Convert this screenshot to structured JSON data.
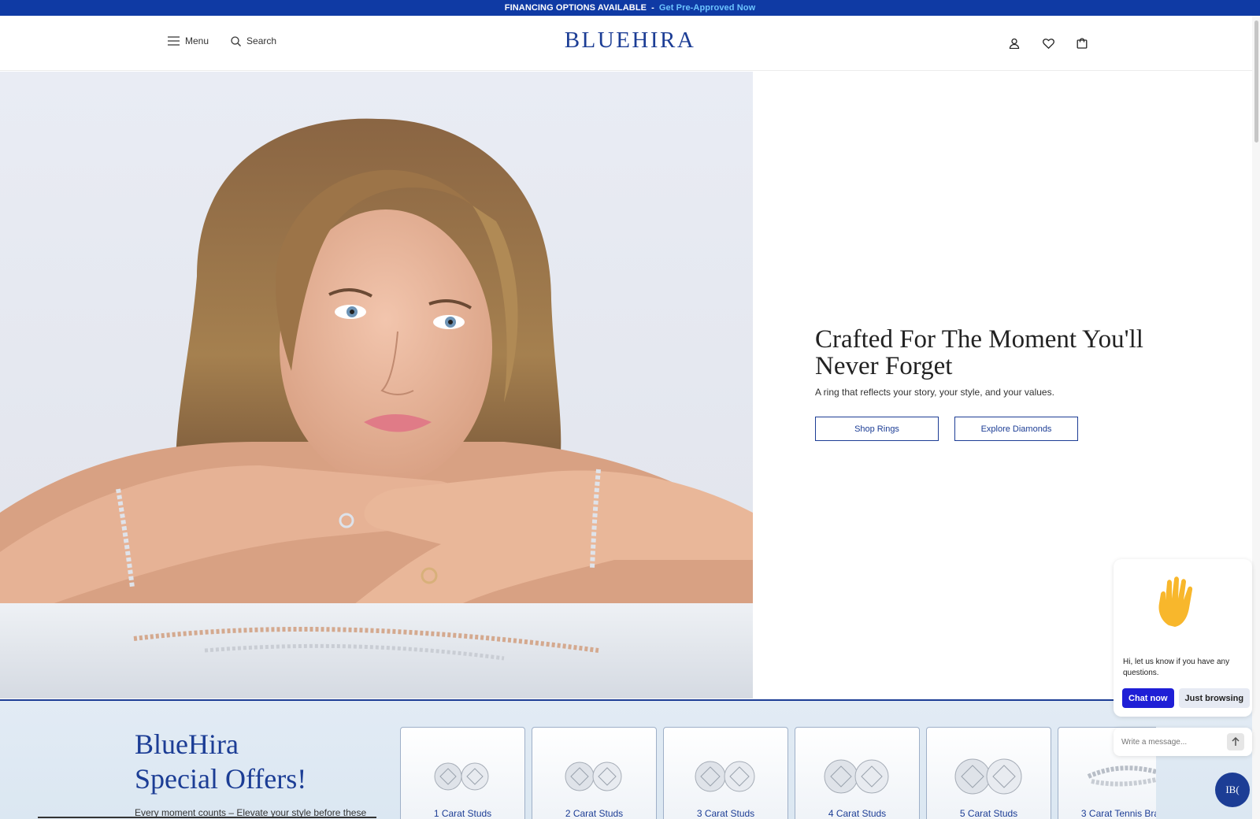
{
  "announcement": {
    "text": "FINANCING OPTIONS AVAILABLE",
    "separator": "-",
    "link": "Get Pre-Approved Now"
  },
  "header": {
    "menu_label": "Menu",
    "search_label": "Search",
    "logo": "BLUEHIRA",
    "icons": [
      "account-icon",
      "wishlist-heart-icon",
      "cart-bag-icon"
    ]
  },
  "hero": {
    "title_line1": "Crafted For The Moment You'll",
    "title_line2": "Never Forget",
    "subtitle": "A ring that reflects your story, your style, and your values.",
    "buttons": {
      "shop_rings": "Shop Rings",
      "explore_diamonds": "Explore Diamonds"
    }
  },
  "offers": {
    "title_line1": "BlueHira",
    "title_line2": "Special Offers!",
    "description": "Every moment counts – Elevate your style before these",
    "cards": [
      {
        "label": "1 Carat Studs"
      },
      {
        "label": "2 Carat Studs"
      },
      {
        "label": "3 Carat Studs"
      },
      {
        "label": "4 Carat Studs"
      },
      {
        "label": "5 Carat Studs"
      },
      {
        "label": "3 Carat Tennis Bra"
      }
    ]
  },
  "chat": {
    "message": "Hi, let us know if you have any questions.",
    "chat_now": "Chat now",
    "just_browsing": "Just browsing",
    "input_placeholder": "Write a message...",
    "fab_label": "IB("
  },
  "colors": {
    "brand_blue": "#1c3d95",
    "announcement_bg": "#0f3aa4",
    "announcement_link": "#6cc4ff",
    "chat_button": "#1f1fd6"
  }
}
